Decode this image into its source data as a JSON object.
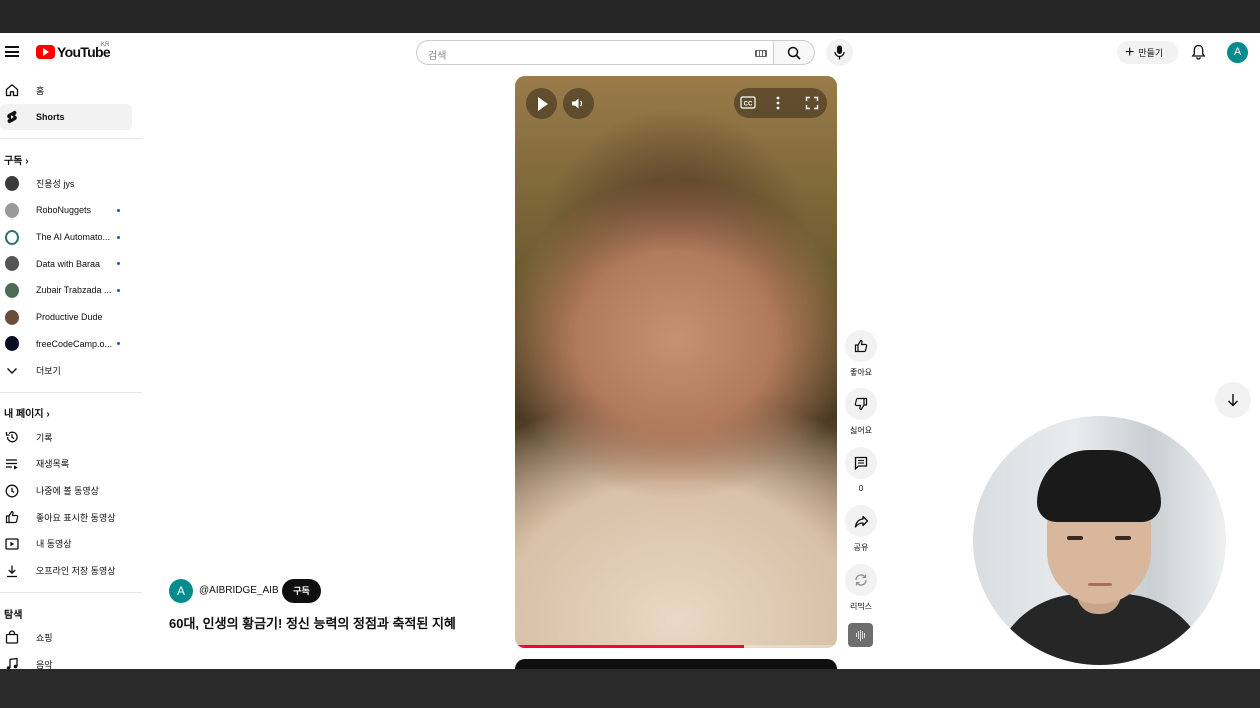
{
  "header": {
    "logo_text": "YouTube",
    "region": "KR",
    "search_placeholder": "검색",
    "create_label": "만들기",
    "avatar_letter": "A"
  },
  "sidebar": {
    "main": [
      {
        "label": "홈",
        "icon": "home-icon"
      },
      {
        "label": "Shorts",
        "icon": "shorts-icon",
        "active": true
      }
    ],
    "subscriptions_title": "구독",
    "subscriptions": [
      {
        "label": "진용성 jys",
        "color": "#3b3b3b",
        "new": false
      },
      {
        "label": "RoboNuggets",
        "color": "#9a9a9a",
        "new": true
      },
      {
        "label": "The AI Automato...",
        "color": "#2e6f6f",
        "new": true
      },
      {
        "label": "Data with Baraa",
        "color": "#555555",
        "new": true
      },
      {
        "label": "Zubair Trabzada ...",
        "color": "#4d6b55",
        "new": true
      },
      {
        "label": "Productive Dude",
        "color": "#6b4c3c",
        "new": false
      },
      {
        "label": "freeCodeCamp.o...",
        "color": "#0a0a23",
        "new": true
      }
    ],
    "more_label": "더보기",
    "you_title": "내 페이지",
    "you_items": [
      {
        "label": "기록",
        "icon": "history-icon"
      },
      {
        "label": "재생목록",
        "icon": "playlist-icon"
      },
      {
        "label": "나중에 볼 동영상",
        "icon": "watch-later-icon"
      },
      {
        "label": "좋아요 표시한 동영상",
        "icon": "thumbs-up-icon"
      },
      {
        "label": "내 동영상",
        "icon": "my-videos-icon"
      },
      {
        "label": "오프라인 저장 동영상",
        "icon": "download-icon"
      }
    ],
    "explore_title": "탐색",
    "explore_items": [
      {
        "label": "쇼핑",
        "icon": "shopping-icon"
      },
      {
        "label": "음악",
        "icon": "music-icon"
      }
    ]
  },
  "short": {
    "channel_letter": "A",
    "channel_handle": "@AIBRIDGE_AIB",
    "subscribe_label": "구독",
    "title": "60대, 인생의 황금기! 정신 능력의 정점과 축적된 지혜",
    "progress": 0.71
  },
  "actions": {
    "like_label": "좋아요",
    "dislike_label": "싫어요",
    "comments_count": "0",
    "share_label": "공유",
    "remix_label": "리믹스"
  }
}
